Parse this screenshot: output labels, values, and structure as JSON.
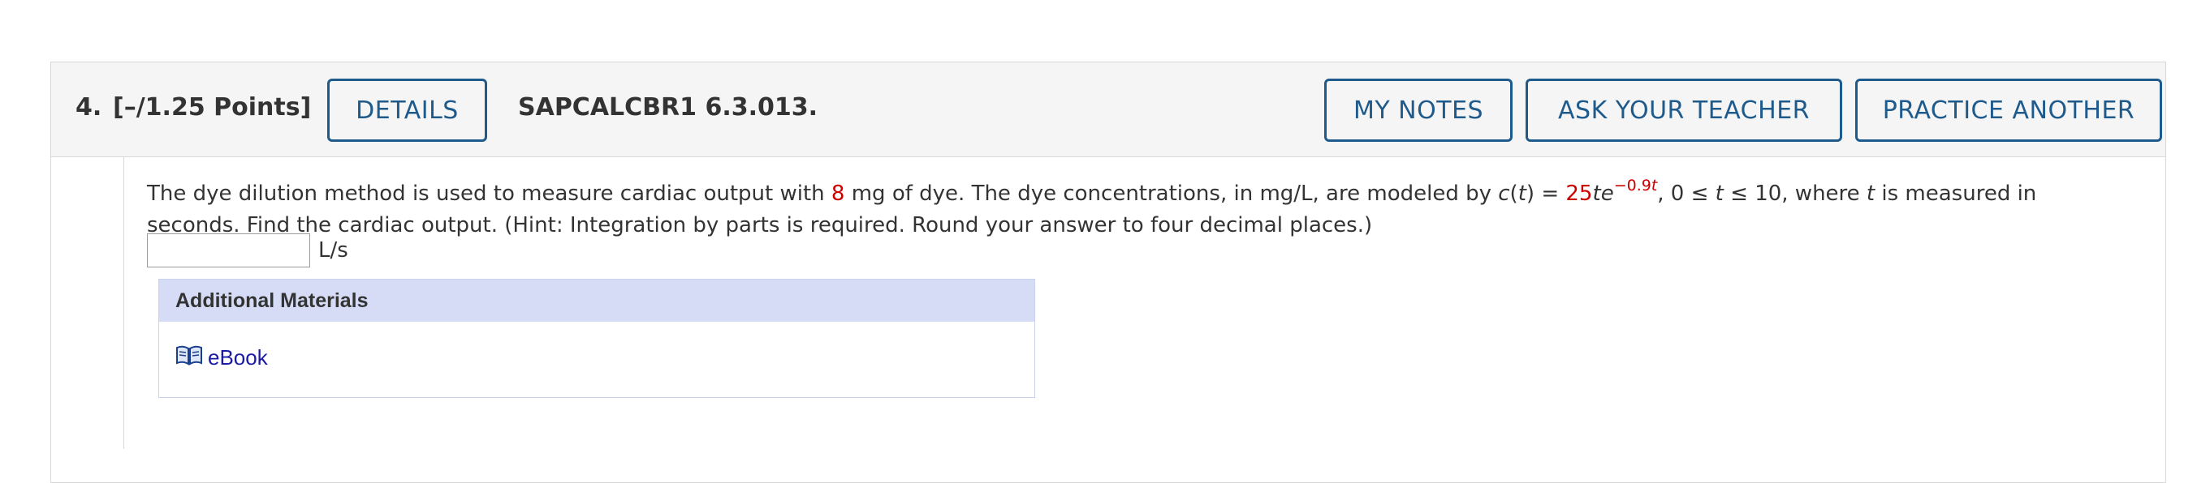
{
  "question": {
    "number": "4.",
    "points": "[–/1.25 Points]",
    "details_label": "DETAILS",
    "code": "SAPCALCBR1 6.3.013.",
    "my_notes_label": "MY NOTES",
    "ask_teacher_label": "ASK YOUR TEACHER",
    "practice_another_label": "PRACTICE ANOTHER"
  },
  "problem": {
    "text_part1": "The dye dilution method is used to measure cardiac output with ",
    "dye_amount": "8",
    "text_part2": " mg of dye. The dye concentrations, in mg/L, are modeled by  ",
    "func_name": "c",
    "func_var": "t",
    "func_eq": " = ",
    "coef": "25",
    "func_t": "t",
    "func_e": "e",
    "exponent": "−0.9",
    "exponent_var": "t",
    "domain_sep": ",   0 ≤ ",
    "domain_var": "t",
    "domain_end": " ≤ 10,  where ",
    "where_var": "t",
    "text_part3": " is measured in seconds. Find the cardiac output. (Hint: Integration by parts is required. Round your answer to four decimal places.)"
  },
  "answer": {
    "value": "",
    "placeholder": "",
    "unit": "L/s"
  },
  "materials": {
    "header": "Additional Materials",
    "ebook_label": "eBook",
    "ebook_icon": "open-book-icon"
  },
  "colors": {
    "accent": "#1f5a8c",
    "highlight_red": "#cc0000",
    "materials_header_bg": "#d6dcf5",
    "link": "#1a1aa6"
  }
}
